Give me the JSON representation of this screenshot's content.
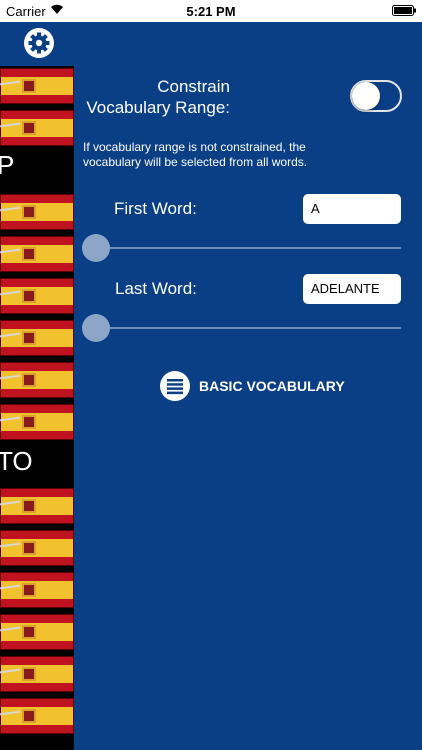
{
  "status_bar": {
    "carrier": "Carrier",
    "time": "5:21 PM"
  },
  "strip": {
    "letter_top": "P",
    "letter_mid": "TO"
  },
  "settings": {
    "constrain_label_line1": "Constrain",
    "constrain_label_line2": "Vocabulary Range:",
    "constrain_toggle_on": false,
    "note": "If vocabulary range is not constrained, the vocabulary will be selected from all words.",
    "first_word_label": "First Word:",
    "first_word_value": "A",
    "first_word_slider": 0,
    "last_word_label": "Last Word:",
    "last_word_value": "ADELANTE",
    "last_word_slider": 0,
    "basic_button_label": "BASIC VOCABULARY"
  },
  "colors": {
    "panel_bg": "#0a3f86",
    "slider_thumb": "#8da6c8"
  }
}
